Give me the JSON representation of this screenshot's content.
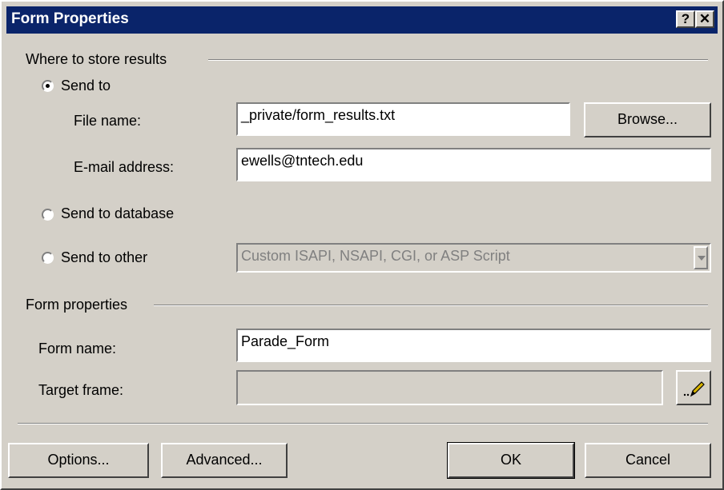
{
  "window": {
    "title": "Form Properties",
    "help_label": "?",
    "close_label": "✕"
  },
  "store_group": {
    "label": "Where to store results",
    "send_to": {
      "label": "Send to",
      "selected": true
    },
    "file_name": {
      "label": "File name:",
      "value": "_private/form_results.txt"
    },
    "browse_label": "Browse...",
    "email": {
      "label": "E-mail address:",
      "value": "ewells@tntech.edu"
    },
    "send_to_database": {
      "label": "Send to database",
      "selected": false
    },
    "send_to_other": {
      "label": "Send to other",
      "selected": false,
      "select_value": "Custom ISAPI, NSAPI, CGI, or ASP Script"
    }
  },
  "form_group": {
    "label": "Form properties",
    "form_name": {
      "label": "Form name:",
      "value": "Parade_Form"
    },
    "target_frame": {
      "label": "Target frame:",
      "value": ""
    },
    "target_button_icon": "pencil-icon"
  },
  "buttons": {
    "options": "Options...",
    "advanced": "Advanced...",
    "ok": "OK",
    "cancel": "Cancel"
  }
}
